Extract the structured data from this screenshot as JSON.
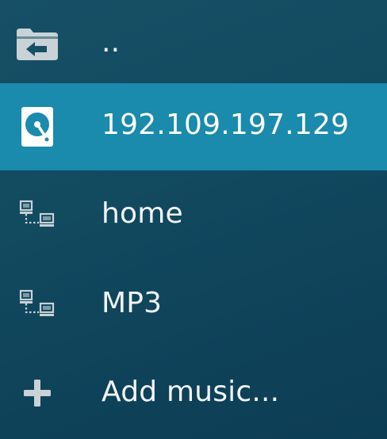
{
  "items": [
    {
      "label": "..",
      "icon": "folder-back-icon",
      "selected": false
    },
    {
      "label": "192.109.197.129",
      "icon": "hard-drive-icon",
      "selected": true
    },
    {
      "label": "home",
      "icon": "network-share-icon",
      "selected": false
    },
    {
      "label": "MP3",
      "icon": "network-share-icon",
      "selected": false
    },
    {
      "label": "Add music...",
      "icon": "plus-icon",
      "selected": false
    }
  ],
  "colors": {
    "background": "#124a60",
    "selected": "#1a8aad",
    "icon": "#c9d2d6",
    "text": "#f2f6f8"
  }
}
